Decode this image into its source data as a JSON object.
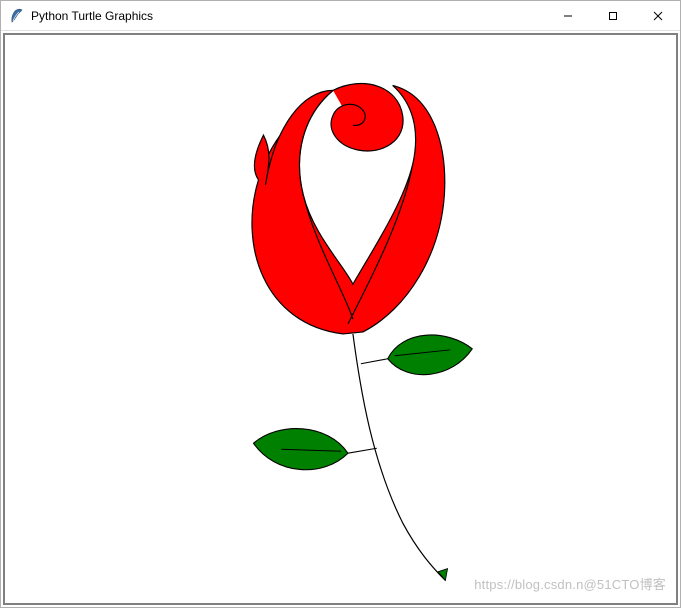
{
  "window": {
    "title": "Python Turtle Graphics",
    "icon_name": "turtle-feather-icon",
    "controls": {
      "minimize": "—",
      "maximize": "☐",
      "close": "✕"
    }
  },
  "canvas": {
    "background": "#ffffff",
    "drawing": {
      "description": "Red rose with green leaves and stem drawn with turtle graphics",
      "colors": {
        "petal_fill": "#ff0000",
        "petal_outline": "#000000",
        "leaf_fill": "#008000",
        "leaf_outline": "#000000",
        "stem": "#000000",
        "turtle_cursor": "#008000"
      }
    }
  },
  "watermark": "https://blog.csdn.n@51CTO博客"
}
